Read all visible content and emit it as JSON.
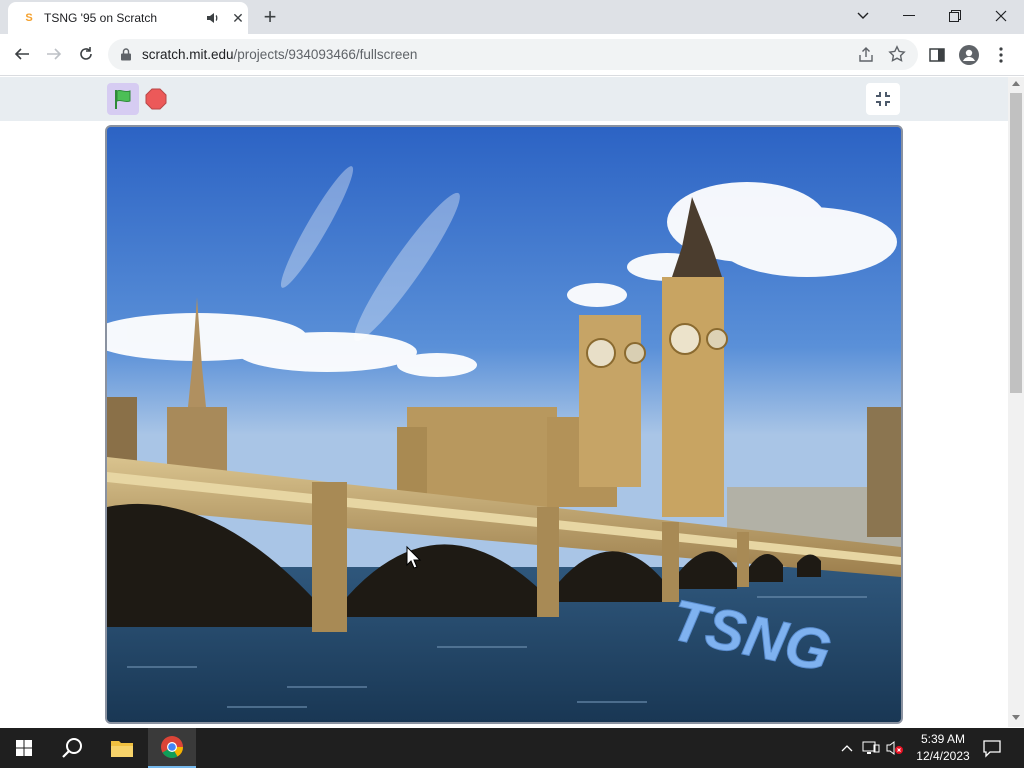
{
  "browser": {
    "tab": {
      "title": "TSNG '95 on Scratch",
      "close_glyph": "✕",
      "favicon_glyph": "S"
    },
    "new_tab_glyph": "+",
    "url": {
      "host": "scratch.mit.edu",
      "path": "/projects/934093466/fullscreen"
    }
  },
  "scratch": {
    "stage_text": "TSNG"
  },
  "taskbar": {
    "time": "5:39 AM",
    "date": "12/4/2023"
  },
  "colors": {
    "tabstrip_bg": "#dee1e6",
    "scratch_bar_bg": "#e8edf1",
    "green_flag_active_bg": "#d6ccf2",
    "stop_red": "#ec5959",
    "flag_green": "#4cbf56",
    "taskbar_bg": "#1f1f1f",
    "stage_text_color": "#7fb2f0"
  }
}
